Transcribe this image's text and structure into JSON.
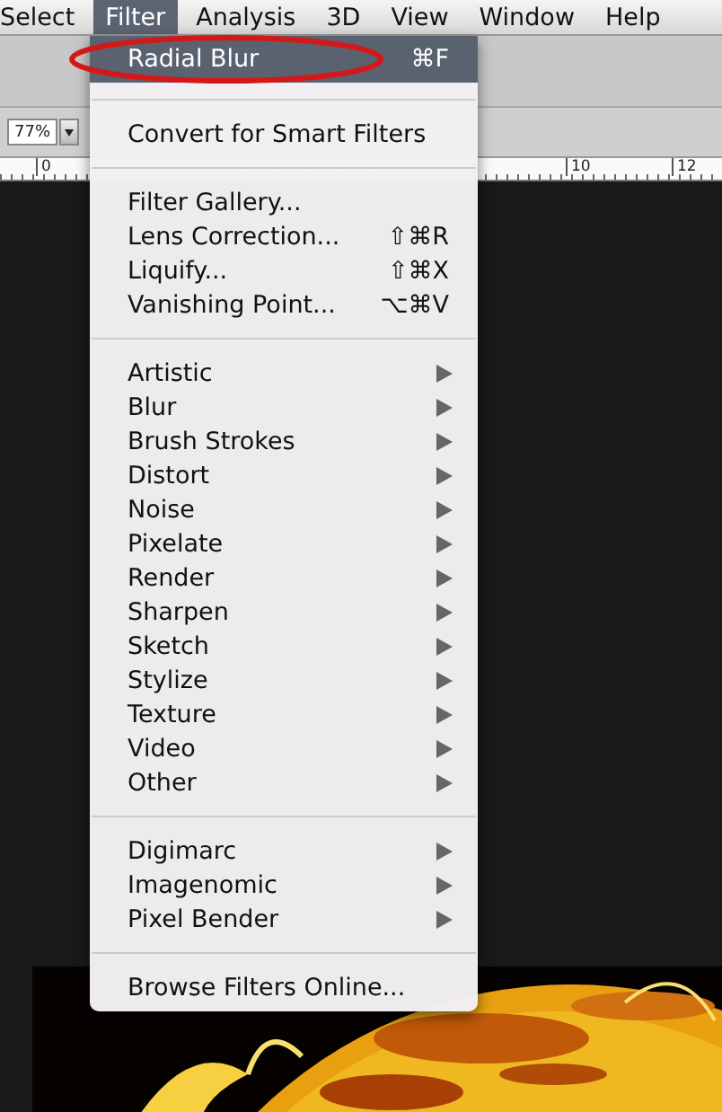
{
  "menu_bar": [
    {
      "label": "Select",
      "selected": false
    },
    {
      "label": "Filter",
      "selected": true
    },
    {
      "label": "Analysis",
      "selected": false
    },
    {
      "label": "3D",
      "selected": false
    },
    {
      "label": "View",
      "selected": false
    },
    {
      "label": "Window",
      "selected": false
    },
    {
      "label": "Help",
      "selected": false
    }
  ],
  "options_bar": {
    "zoom_field": {
      "value": "77%"
    }
  },
  "ruler": {
    "labels": [
      {
        "label": "0"
      },
      {
        "label": "10"
      },
      {
        "label": "12"
      }
    ]
  },
  "filter_menu": {
    "groups": [
      {
        "items": [
          {
            "label": "Radial Blur",
            "shortcut": "⌘F",
            "submenu": false,
            "selected": true,
            "circled": true
          }
        ]
      },
      {
        "items": [
          {
            "label": "Convert for Smart Filters",
            "submenu": false,
            "selected": false
          }
        ]
      },
      {
        "items": [
          {
            "label": "Filter Gallery...",
            "submenu": false,
            "selected": false
          },
          {
            "label": "Lens Correction...",
            "shortcut": "⇧⌘R",
            "submenu": false,
            "selected": false
          },
          {
            "label": "Liquify...",
            "shortcut": "⇧⌘X",
            "submenu": false,
            "selected": false
          },
          {
            "label": "Vanishing Point...",
            "shortcut": "⌥⌘V",
            "submenu": false,
            "selected": false
          }
        ]
      },
      {
        "items": [
          {
            "label": "Artistic",
            "submenu": true,
            "selected": false
          },
          {
            "label": "Blur",
            "submenu": true,
            "selected": false
          },
          {
            "label": "Brush Strokes",
            "submenu": true,
            "selected": false
          },
          {
            "label": "Distort",
            "submenu": true,
            "selected": false
          },
          {
            "label": "Noise",
            "submenu": true,
            "selected": false
          },
          {
            "label": "Pixelate",
            "submenu": true,
            "selected": false
          },
          {
            "label": "Render",
            "submenu": true,
            "selected": false
          },
          {
            "label": "Sharpen",
            "submenu": true,
            "selected": false
          },
          {
            "label": "Sketch",
            "submenu": true,
            "selected": false
          },
          {
            "label": "Stylize",
            "submenu": true,
            "selected": false
          },
          {
            "label": "Texture",
            "submenu": true,
            "selected": false
          },
          {
            "label": "Video",
            "submenu": true,
            "selected": false
          },
          {
            "label": "Other",
            "submenu": true,
            "selected": false
          }
        ]
      },
      {
        "items": [
          {
            "label": "Digimarc",
            "submenu": true,
            "selected": false
          },
          {
            "label": "Imagenomic",
            "submenu": true,
            "selected": false
          },
          {
            "label": "Pixel Bender",
            "submenu": true,
            "selected": false
          }
        ]
      },
      {
        "items": [
          {
            "label": "Browse Filters Online...",
            "submenu": false,
            "selected": false
          }
        ]
      }
    ]
  }
}
